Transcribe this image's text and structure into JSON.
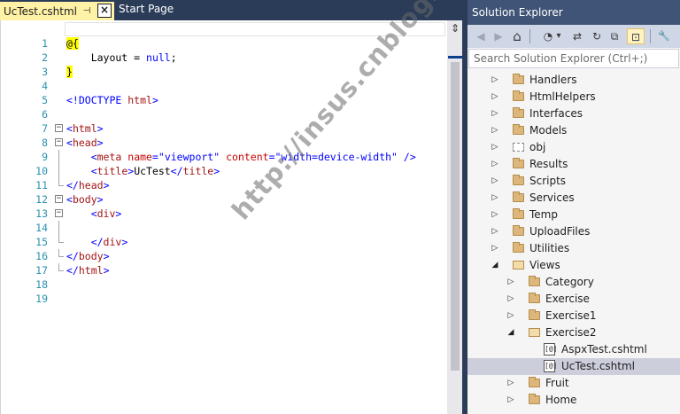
{
  "tabs": {
    "active": "UcTest.cshtml",
    "inactive": "Start Page",
    "pin_glyph": "⊣",
    "close_glyph": "×"
  },
  "editor": {
    "lines": [
      {
        "n": "1"
      },
      {
        "n": "2"
      },
      {
        "n": "3"
      },
      {
        "n": "4"
      },
      {
        "n": "5"
      },
      {
        "n": "6"
      },
      {
        "n": "7"
      },
      {
        "n": "8"
      },
      {
        "n": "9"
      },
      {
        "n": "10"
      },
      {
        "n": "11"
      },
      {
        "n": "12"
      },
      {
        "n": "13"
      },
      {
        "n": "14"
      },
      {
        "n": "15"
      },
      {
        "n": "16"
      },
      {
        "n": "17"
      },
      {
        "n": "18"
      },
      {
        "n": "19"
      }
    ],
    "code": {
      "l2": "@{",
      "l3_a": "    Layout = ",
      "l3_b": "null",
      "l3_c": ";",
      "l4": "}",
      "l6_a": "<!DOCTYPE ",
      "l6_b": "html",
      "l6_c": ">",
      "l8_a": "<",
      "l8_b": "html",
      "l8_c": ">",
      "l9_a": "<",
      "l9_b": "head",
      "l9_c": ">",
      "l10_a": "    <",
      "l10_b": "meta",
      "l10_c": " ",
      "l10_d": "name",
      "l10_e": "=",
      "l10_f": "\"viewport\"",
      "l10_g": " ",
      "l10_h": "content",
      "l10_i": "=",
      "l10_j": "\"width=device-width\"",
      "l10_k": " />",
      "l11_a": "    <",
      "l11_b": "title",
      "l11_c": ">",
      "l11_d": "UcTest",
      "l11_e": "</",
      "l11_f": "title",
      "l11_g": ">",
      "l12_a": "</",
      "l12_b": "head",
      "l12_c": ">",
      "l13_a": "<",
      "l13_b": "body",
      "l13_c": ">",
      "l14_a": "    <",
      "l14_b": "div",
      "l14_c": ">",
      "l16_a": "    </",
      "l16_b": "div",
      "l16_c": ">",
      "l17_a": "</",
      "l17_b": "body",
      "l17_c": ">",
      "l18_a": "</",
      "l18_b": "html",
      "l18_c": ">"
    },
    "fold_glyph": "−"
  },
  "scrollbar": {
    "split_glyph": "⇕"
  },
  "solution_explorer": {
    "title": "Solution Explorer",
    "search_placeholder": "Search Solution Explorer (Ctrl+;)",
    "toolbar": {
      "back": "◀",
      "forward": "▶",
      "home": "⌂",
      "history": "◔",
      "history_dropdown": "▾",
      "sync": "⇄",
      "refresh": "↻",
      "collapse": "⧉",
      "show_files": "⊡",
      "properties": "🔧"
    },
    "tree": [
      {
        "label": "Handlers",
        "expander": "▷",
        "icon": "folder",
        "indent": 0
      },
      {
        "label": "HtmlHelpers",
        "expander": "▷",
        "icon": "folder",
        "indent": 0
      },
      {
        "label": "Interfaces",
        "expander": "▷",
        "icon": "folder",
        "indent": 0
      },
      {
        "label": "Models",
        "expander": "▷",
        "icon": "folder",
        "indent": 0
      },
      {
        "label": "obj",
        "expander": "▷",
        "icon": "folder-dashed",
        "indent": 0
      },
      {
        "label": "Results",
        "expander": "▷",
        "icon": "folder",
        "indent": 0
      },
      {
        "label": "Scripts",
        "expander": "▷",
        "icon": "folder",
        "indent": 0
      },
      {
        "label": "Services",
        "expander": "▷",
        "icon": "folder",
        "indent": 0
      },
      {
        "label": "Temp",
        "expander": "▷",
        "icon": "folder",
        "indent": 0
      },
      {
        "label": "UploadFiles",
        "expander": "▷",
        "icon": "folder",
        "indent": 0
      },
      {
        "label": "Utilities",
        "expander": "▷",
        "icon": "folder",
        "indent": 0
      },
      {
        "label": "Views",
        "expander": "◢",
        "icon": "folder-open",
        "indent": 0
      },
      {
        "label": "Category",
        "expander": "▷",
        "icon": "folder",
        "indent": 1
      },
      {
        "label": "Exercise",
        "expander": "▷",
        "icon": "folder",
        "indent": 1
      },
      {
        "label": "Exercise1",
        "expander": "▷",
        "icon": "folder",
        "indent": 1
      },
      {
        "label": "Exercise2",
        "expander": "◢",
        "icon": "folder-open",
        "indent": 1
      },
      {
        "label": "AspxTest.cshtml",
        "expander": "",
        "icon": "file",
        "indent": 2
      },
      {
        "label": "UcTest.cshtml",
        "expander": "",
        "icon": "file",
        "indent": 2,
        "selected": true
      },
      {
        "label": "Fruit",
        "expander": "▷",
        "icon": "folder",
        "indent": 1
      },
      {
        "label": "Home",
        "expander": "▷",
        "icon": "folder",
        "indent": 1
      }
    ],
    "file_icon_glyph": "[@]"
  },
  "watermark": "http://insus.cnblogs.com"
}
